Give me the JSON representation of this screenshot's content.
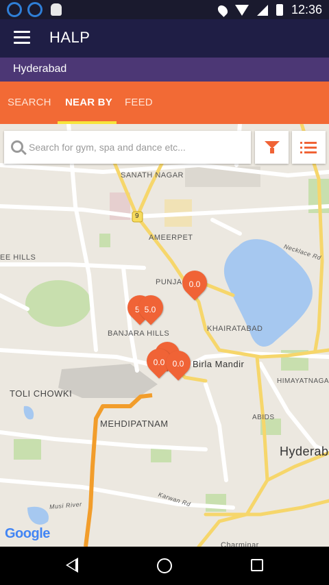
{
  "status_bar": {
    "time": "12:36"
  },
  "app_bar": {
    "title": "HALP"
  },
  "city": "Hyderabad",
  "tabs": [
    {
      "label": "SEARCH",
      "active": false
    },
    {
      "label": "NEAR BY",
      "active": true
    },
    {
      "label": "FEED",
      "active": false
    }
  ],
  "search": {
    "placeholder": "Search for gym, spa and dance etc..."
  },
  "colors": {
    "accent": "#f26a35",
    "app_bar": "#1f1e45",
    "city_bar": "#4c3775",
    "tab_indicator": "#f7e43a",
    "marker": "#f06336"
  },
  "map": {
    "labels": {
      "sanath_nagar": "SANATH NAGAR",
      "route_9": "9",
      "ameerpet": "AMEERPET",
      "ee_hills": "EE HILLS",
      "necklace_rd": "Necklace Rd",
      "punjag": "PUNJAG",
      "khairatabad": "KHAIRATABAD",
      "banjara_hills": "BANJARA HILLS",
      "birla_mandir": "Birla Mandir",
      "himayatnagar": "HIMAYATNAGAR",
      "toli_chowki": "TOLI CHOWKI",
      "mehdipatnam": "MEHDIPATNAM",
      "abids": "ABIDS",
      "hyderab": "Hyderab",
      "musi_river": "Musi River",
      "karwan_rd": "Karwan Rd",
      "charminar": "Charminar"
    },
    "markers": [
      "0.0",
      "5.",
      "5.0",
      "0.0",
      "0.0"
    ],
    "attribution": "Google"
  },
  "nav": {
    "back_icon": "back-triangle",
    "home_icon": "home-circle",
    "recents_icon": "recents-square"
  }
}
